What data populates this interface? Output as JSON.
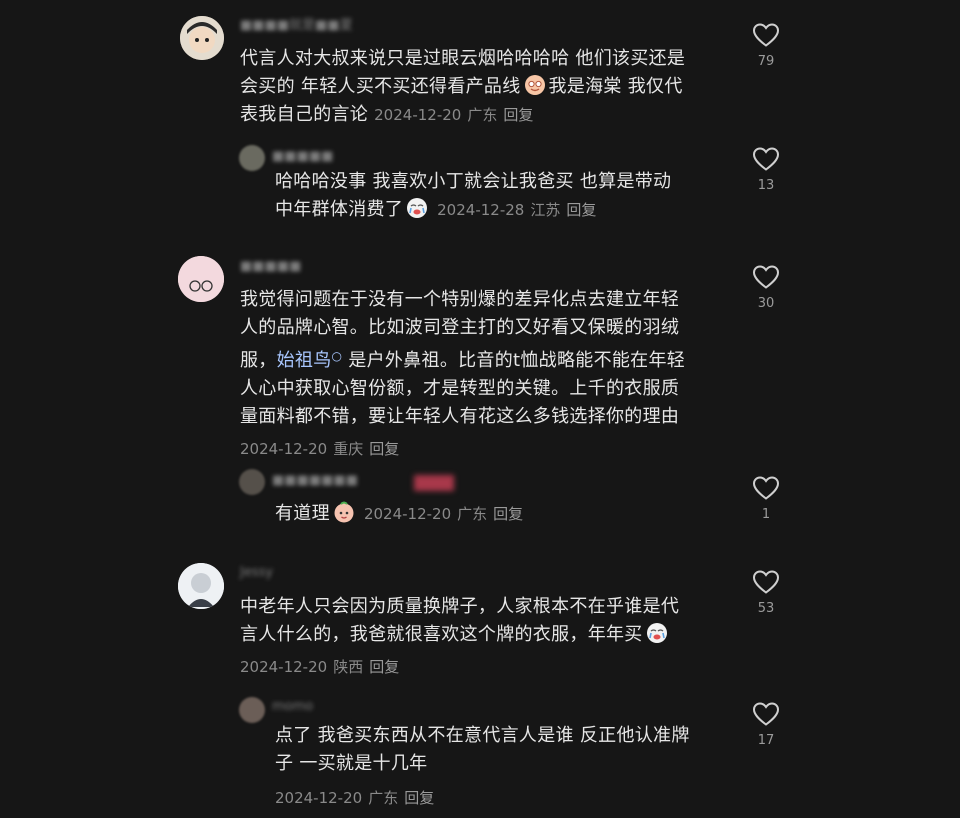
{
  "comments": [
    {
      "user": "■■■■就是■■夏",
      "text_lines": [
        "代言人对大叔来说只是过眼云烟哈哈哈哈 他们该买还是",
        "会买的  年轻人买不买还得看产品线",
        "表我自己的言论"
      ],
      "line2_tail": "我是海棠 我仅代",
      "date": "2024-12-20",
      "location": "广东",
      "reply": "回复",
      "likes": "79"
    },
    {
      "user": "■■■■■",
      "text_lines": [
        "哈哈哈没事  我喜欢小丁就会让我爸买  也算是带动",
        "中年群体消费了"
      ],
      "date": "2024-12-28",
      "location": "江苏",
      "reply": "回复",
      "likes": "13"
    },
    {
      "user": "■■■■■",
      "text_lines": [
        "我觉得问题在于没有一个特别爆的差异化点去建立年轻",
        "人的品牌心智。比如波司登主打的又好看又保暖的羽绒",
        "服，",
        " 是户外鼻祖。比音的t恤战略能不能在年轻",
        "人心中获取心智份额，才是转型的关键。上千的衣服质",
        "量面料都不错，要让年轻人有花这么多钱选择你的理由"
      ],
      "link": "始祖鸟",
      "date": "2024-12-20",
      "location": "重庆",
      "reply": "回复",
      "likes": "30"
    },
    {
      "user": "■■■■■■■",
      "text": "有道理",
      "date": "2024-12-20",
      "location": "广东",
      "reply": "回复",
      "likes": "1"
    },
    {
      "user": "Jessy",
      "text_lines": [
        "中老年人只会因为质量换牌子，人家根本不在乎谁是代",
        "言人什么的，我爸就很喜欢这个牌的衣服，年年买"
      ],
      "date": "2024-12-20",
      "location": "陕西",
      "reply": "回复",
      "likes": "53"
    },
    {
      "user": "momo",
      "text_lines": [
        "点了 我爸买东西从不在意代言人是谁 反正他认准牌",
        "子 一买就是十几年"
      ],
      "date": "2024-12-20",
      "location": "广东",
      "reply": "回复",
      "likes": "17"
    }
  ],
  "icons": {
    "like": "heart-outline-icon",
    "emoji": "emoji-sticker-icon",
    "link": "search-link-icon"
  }
}
